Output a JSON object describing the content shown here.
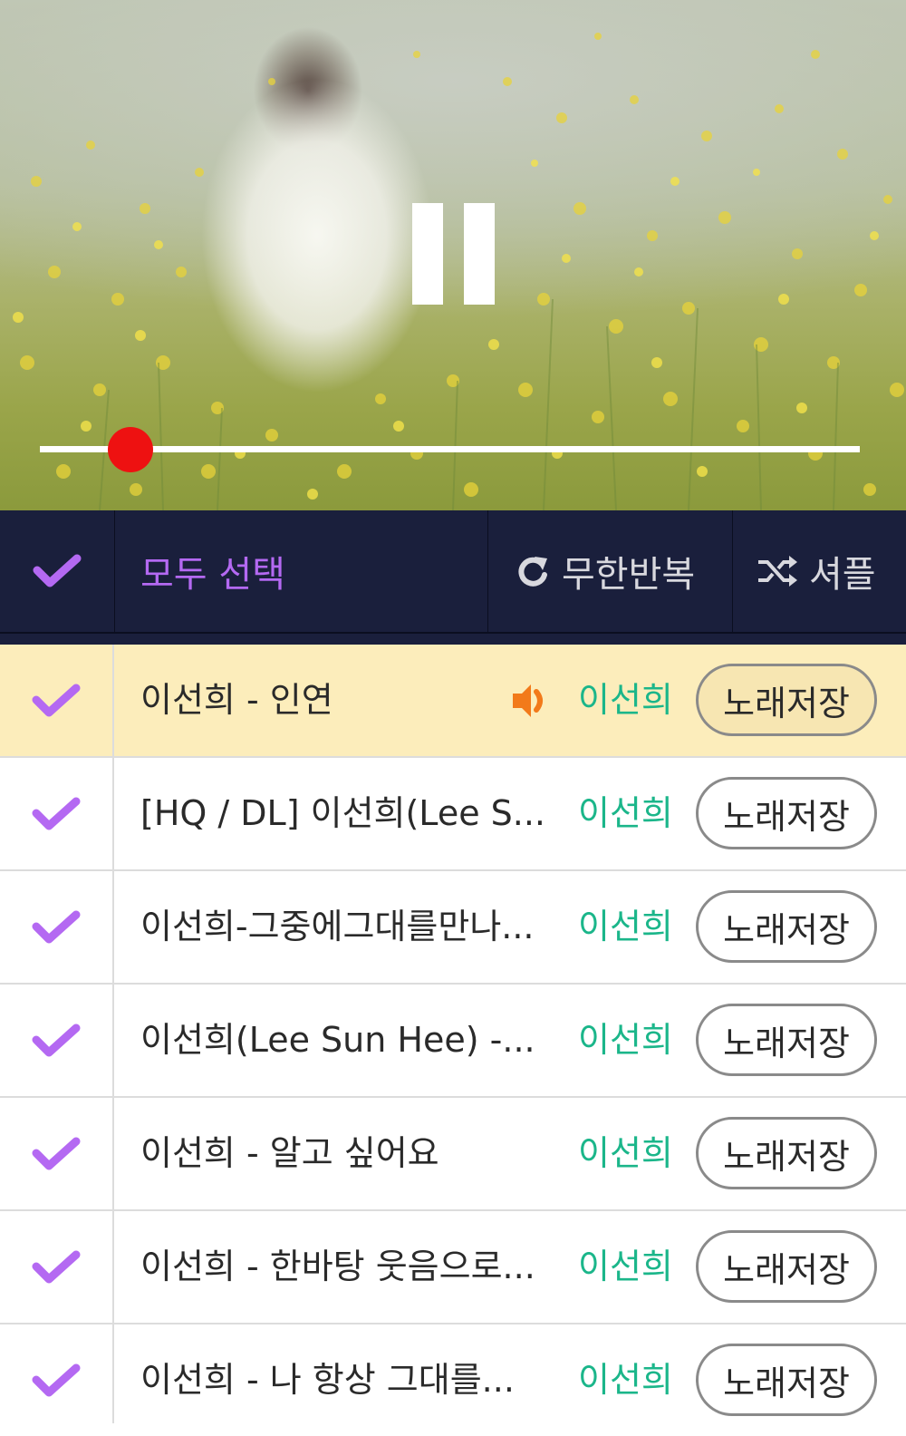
{
  "player": {
    "state_icon": "pause-icon",
    "seek_progress": 0.11,
    "seek_color": "#ee1111"
  },
  "toolbar": {
    "select_all_label": "모두 선택",
    "repeat_label": "무한반복",
    "shuffle_label": "셔플",
    "accent_color": "#b469f2",
    "background_color": "#1a1f3c"
  },
  "playlist": {
    "items": [
      {
        "title": "이선희 - 인연",
        "artist": "이선희",
        "save_label": "노래저장",
        "now_playing": true
      },
      {
        "title": "[HQ / DL] 이선희(Lee S...",
        "artist": "이선희",
        "save_label": "노래저장",
        "now_playing": false
      },
      {
        "title": "이선희-그중에그대를만나...",
        "artist": "이선희",
        "save_label": "노래저장",
        "now_playing": false
      },
      {
        "title": "이선희(Lee Sun Hee) -...",
        "artist": "이선희",
        "save_label": "노래저장",
        "now_playing": false
      },
      {
        "title": "이선희 - 알고 싶어요",
        "artist": "이선희",
        "save_label": "노래저장",
        "now_playing": false
      },
      {
        "title": "이선희 - 한바탕 웃음으로...",
        "artist": "이선희",
        "save_label": "노래저장",
        "now_playing": false
      },
      {
        "title": "이선희 - 나 항상 그대를...",
        "artist": "이선희",
        "save_label": "노래저장",
        "now_playing": false
      }
    ],
    "artist_color": "#1bb68a",
    "check_color": "#b469f2",
    "active_row_color": "#fcedbb"
  }
}
